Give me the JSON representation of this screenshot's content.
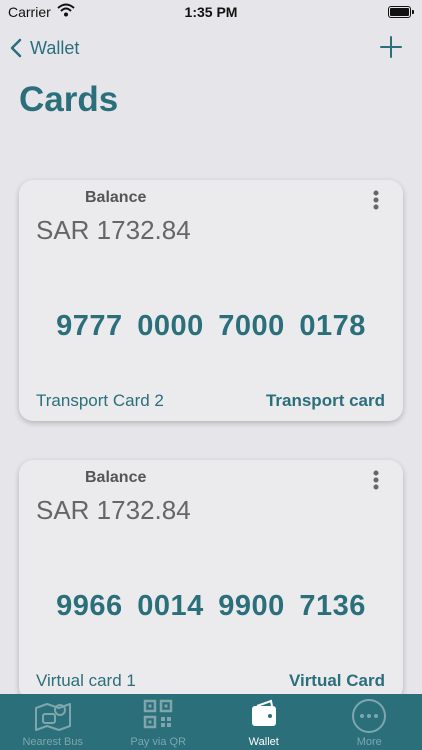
{
  "status_bar": {
    "carrier": "Carrier",
    "time": "1:35 PM"
  },
  "nav": {
    "back_label": "Wallet"
  },
  "page": {
    "title": "Cards"
  },
  "cards": [
    {
      "balance_label": "Balance",
      "balance": "SAR 1732.84",
      "number": "9777 0000 7000 0178",
      "name": "Transport Card 2",
      "type": "Transport card"
    },
    {
      "balance_label": "Balance",
      "balance": "SAR 1732.84",
      "number": "9966 0014 9900 7136",
      "name": "Virtual card 1",
      "type": "Virtual Card"
    }
  ],
  "tabs": [
    {
      "label": "Nearest Bus",
      "icon": "bus-map-icon",
      "active": false
    },
    {
      "label": "Pay via QR",
      "icon": "qr-code-icon",
      "active": false
    },
    {
      "label": "Wallet",
      "icon": "wallet-icon",
      "active": true
    },
    {
      "label": "More",
      "icon": "more-icon",
      "active": false
    }
  ],
  "colors": {
    "accent": "#2b6f7b",
    "background": "#e6e6ea",
    "card": "#ebebee"
  }
}
